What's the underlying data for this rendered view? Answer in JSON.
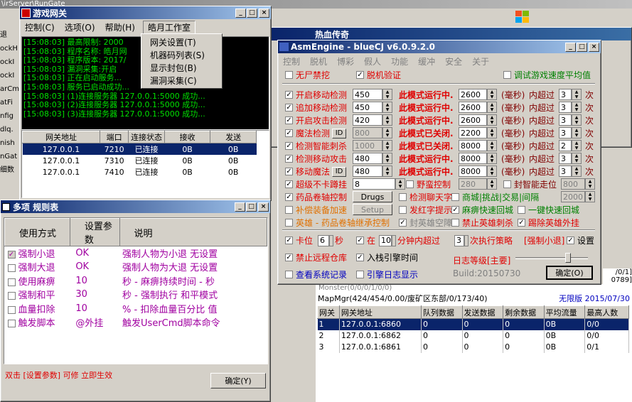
{
  "bg": {
    "top_path": "\\irServer\\RunGate",
    "left_labels": [
      "退",
      "ockH",
      "ockI",
      "ockI",
      "arCm",
      "atFi",
      "nfig",
      "dlq.",
      "nish",
      "nGat",
      "细数"
    ],
    "mid_title": "热血传奇",
    "mid_lines": [
      "本: 2017/07/3",
      "/0/1]",
      "0789]"
    ],
    "status_line": "MapMgr(424/454/0.00/废矿区东部/0/173/40)",
    "status_line_above": "Monster(0/0/0/1/0/0)",
    "free_label": "无限版",
    "date": "2015/07/30"
  },
  "gw": {
    "title": "游戏网关",
    "menu": [
      "控制(C)",
      "选项(O)",
      "帮助(H)",
      "皓月工作室"
    ],
    "logs": [
      "[15:08:03] 最高限制: 2000",
      "[15:08:03] 程序名称: 皓月网",
      "[15:08:03] 程序版本: 2017/",
      "[15:08:03] 漏洞采集:开启",
      "[15:08:03] 正在启动服务...",
      "[15:08:03] 服务已启动成功...",
      "[15:08:03] (1)连接服务器 127.0.0.1:5000 成功...",
      "[15:08:03] (2)连接服务器 127.0.0.1:5000 成功...",
      "[15:08:03] (3)连接服务器 127.0.0.1:5000 成功..."
    ],
    "cols": [
      "网关地址",
      "端口",
      "连接状态",
      "接收",
      "发送"
    ],
    "rows": [
      [
        "127.0.0.1",
        "7210",
        "已连接",
        "0B",
        "0B"
      ],
      [
        "127.0.0.1",
        "7310",
        "已连接",
        "0B",
        "0B"
      ],
      [
        "127.0.0.1",
        "7410",
        "已连接",
        "0B",
        "0B"
      ]
    ],
    "dropdown": [
      "网关设置(T)",
      "机器码列表(S)",
      "显示封包(B)",
      "漏洞采集(C)"
    ]
  },
  "rules": {
    "title": "多项 规则表",
    "cols": [
      "使用方式",
      "设置参数",
      "说明"
    ],
    "rows": [
      [
        "强制小退",
        "OK",
        "强制人物为小退 无设置"
      ],
      [
        "强制大退",
        "OK",
        "强制人物为大退 无设置"
      ],
      [
        "使用麻痹",
        "10",
        "秒 - 麻痹持续时间 - 秒"
      ],
      [
        "强制和平",
        "30",
        "秒 - 强制执行 和平模式"
      ],
      [
        "血量扣除",
        "10",
        "% - 扣除血量百分比 值"
      ],
      [
        "触发脚本",
        "@外挂",
        "触发UserCmd脚本命令"
      ]
    ],
    "hint": "双击 [设置参数] 可修 立即生效",
    "ok": "确定(Y)"
  },
  "asm": {
    "title": "AsmEngine - blueCJ  v6.0.9.2.0",
    "menu": [
      "控制",
      "脱机",
      "博彩",
      "假人",
      "功能",
      "缓冲",
      "安全",
      "关于"
    ],
    "top": {
      "a": "无尸禁挖",
      "b": "脱机验证",
      "c": "调试游戏速度平均值"
    },
    "rows": [
      {
        "label": "开启移动检测",
        "val": "450",
        "status": "此模式运行中.",
        "ms": "2600",
        "unit": "(毫秒)",
        "over": "内超过",
        "count": "3",
        "ci": "次"
      },
      {
        "label": "追加移动检测",
        "val": "450",
        "status": "此模式运行中.",
        "ms": "2600",
        "unit": "(毫秒)",
        "over": "内超过",
        "count": "3",
        "ci": "次"
      },
      {
        "label": "开启攻击检测",
        "val": "420",
        "status": "此模式运行中.",
        "ms": "2600",
        "unit": "(毫秒)",
        "over": "内超过",
        "count": "3",
        "ci": "次"
      },
      {
        "label": "魔法检测",
        "val": "800",
        "status": "此模式已关闭.",
        "ms": "2200",
        "unit": "(毫秒)",
        "over": "内超过",
        "count": "3",
        "ci": "次",
        "id": "ID"
      },
      {
        "label": "检测智能刺杀",
        "val": "1000",
        "status": "此模式已关闭.",
        "ms": "8000",
        "unit": "(毫秒)",
        "over": "内超过",
        "count": "2",
        "ci": "次"
      },
      {
        "label": "检测移动攻击",
        "val": "480",
        "status": "此模式运行中.",
        "ms": "8000",
        "unit": "(毫秒)",
        "over": "内超过",
        "count": "3",
        "ci": "次"
      },
      {
        "label": "移动魔法",
        "val": "480",
        "status": "此模式运行中.",
        "ms": "8000",
        "unit": "(毫秒)",
        "over": "内超过",
        "count": "3",
        "ci": "次",
        "id": "ID"
      }
    ],
    "r8": {
      "a": "超级不卡蹲挂",
      "b": "8",
      "c": "野蛮控制",
      "d": "280",
      "e": "封智能走位",
      "f": "800"
    },
    "r9": {
      "a": "药品卷轴控制",
      "b": "Drugs",
      "c": "检测聊天字",
      "d": "商城|挑战|交易|间隔",
      "e": "2000"
    },
    "r10": {
      "a": "补偿装备加速",
      "b": "Setup",
      "c": "发红字提示",
      "d": "麻痹快速回城",
      "e": "一键快速回城"
    },
    "r11": {
      "a": "英雄 - 药品卷轴继承控制",
      "b": "封英雄空障",
      "c": "禁止英雄刺杀",
      "d": "踢除英雄外挂"
    },
    "r12": {
      "a": "卡位",
      "b": "6",
      "c": "秒",
      "d": "在",
      "e": "10",
      "f": "分钟内超过",
      "g": "3",
      "h": "次执行策略",
      "i": "[强制小退]",
      "j": "设置"
    },
    "r13": {
      "a": "禁止远程仓库",
      "b": "入栈引擎时间",
      "c": "日志等级[主要]"
    },
    "r14": {
      "a": "查看系统记录",
      "b": "引擎日志显示",
      "c": "Build:20150730",
      "d": "确定(O)"
    }
  },
  "bt": {
    "cols": [
      "网关",
      "网关地址",
      "队列数据",
      "发送数据",
      "剩余数据",
      "平均流量",
      "最高人数"
    ],
    "rows": [
      [
        "1",
        "127.0.0.1:6860",
        "0",
        "0",
        "0",
        "0B",
        "0/0"
      ],
      [
        "2",
        "127.0.0.1:6862",
        "0",
        "0",
        "0",
        "0B",
        "0/0"
      ],
      [
        "3",
        "127.0.0.1:6861",
        "0",
        "0",
        "0",
        "0B",
        "0/1"
      ]
    ]
  }
}
